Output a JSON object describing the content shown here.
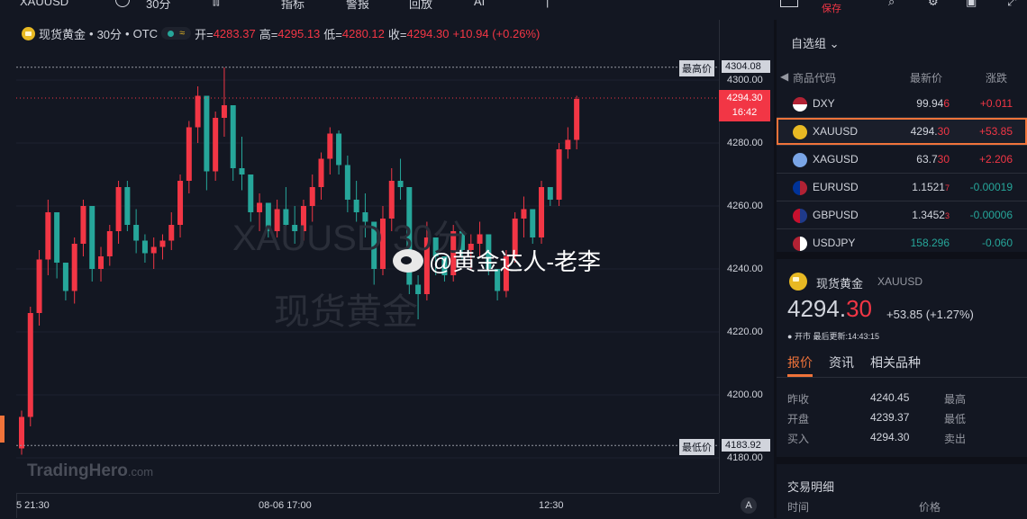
{
  "topbar": {
    "symbol": "XAUUSD",
    "interval": "30分",
    "indicators": "指标",
    "alerts": "警报",
    "replay": "回放",
    "ai": "AI",
    "save": "保存"
  },
  "legend": {
    "name": "现货黄金",
    "interval": "30分",
    "exchange": "OTC",
    "dot_sep": "•",
    "open_label": "开=",
    "open": "4283.37",
    "high_label": "高=",
    "high": "4295.13",
    "low_label": "低=",
    "low": "4280.12",
    "close_label": "收=",
    "close": "4294.30",
    "change": "+10.94 (+0.26%)",
    "pill_icon": "≈"
  },
  "watermark": {
    "line1": "XAUUSD 30分",
    "line2": "现货黄金",
    "brand": "TradingHero",
    "brand_suffix": ".com",
    "social": "@黄金达人-老李"
  },
  "price_axis": {
    "ticks": [
      "4300.00",
      "4280.00",
      "4260.00",
      "4240.00",
      "4220.00",
      "4200.00",
      "4180.00"
    ],
    "high_label": "最高价",
    "high_value": "4304.08",
    "low_label": "最低价",
    "low_value": "4183.92",
    "last_price": "4294.30",
    "countdown": "16:42"
  },
  "time_axis": {
    "ticks": [
      "5 21:30",
      "08-06 17:00",
      "12:30"
    ],
    "auto_button": "A"
  },
  "watchlist": {
    "title": "自选组",
    "headers": {
      "code": "商品代码",
      "last": "最新价",
      "change": "涨跌"
    },
    "rows": [
      {
        "symbol": "DXY",
        "price_main": "99.94",
        "price_tail": "6",
        "change": "+0.011",
        "dir": "up",
        "icon": "us-flag-icon"
      },
      {
        "symbol": "XAUUSD",
        "price_main": "4294.",
        "price_tail": "30",
        "change": "+53.85",
        "dir": "up",
        "icon": "gold-coin-icon"
      },
      {
        "symbol": "XAGUSD",
        "price_main": "63.7",
        "price_tail": "30",
        "change": "+2.206",
        "dir": "up",
        "icon": "silver-coin-icon"
      },
      {
        "symbol": "EURUSD",
        "price_main": "1.1521",
        "price_tail": "7",
        "change": "-0.00019",
        "dir": "down",
        "icon": "eu-us-flag-icon"
      },
      {
        "symbol": "GBPUSD",
        "price_main": "1.3452",
        "price_tail": "3",
        "change": "-0.00006",
        "dir": "down",
        "icon": "gb-us-flag-icon"
      },
      {
        "symbol": "USDJPY",
        "price_main": "158.296",
        "price_tail": "",
        "change": "-0.060",
        "dir": "down",
        "icon": "us-jp-flag-icon"
      }
    ]
  },
  "detail": {
    "name": "现货黄金",
    "symbol": "XAUUSD",
    "price_main": "4294.",
    "price_tail": "30",
    "change": "+53.85 (+1.27%)",
    "status": "开市",
    "updated": "最后更新:14:43:15",
    "tabs": [
      "报价",
      "资讯",
      "相关品种"
    ],
    "quote": [
      {
        "label": "昨收",
        "value": "4240.45",
        "label2": "最高"
      },
      {
        "label": "开盘",
        "value": "4239.37",
        "label2": "最低"
      },
      {
        "label": "买入",
        "value": "4294.30",
        "label2": "卖出"
      }
    ],
    "trades_title": "交易明细",
    "trades_headers": {
      "time": "时间",
      "price": "价格"
    }
  },
  "colors": {
    "up": "#f23645",
    "down": "#26a69a",
    "bg": "#131722",
    "accent": "#e8b923"
  },
  "chart_data": {
    "type": "candlestick",
    "symbol": "XAUUSD",
    "interval": "30分",
    "ylim": [
      4175,
      4310
    ],
    "candles": [
      [
        4183,
        4195,
        4181,
        4193
      ],
      [
        4193,
        4228,
        4190,
        4226
      ],
      [
        4226,
        4246,
        4222,
        4243
      ],
      [
        4243,
        4262,
        4238,
        4258
      ],
      [
        4258,
        4250,
        4237,
        4242
      ],
      [
        4242,
        4236,
        4230,
        4233
      ],
      [
        4233,
        4250,
        4229,
        4248
      ],
      [
        4248,
        4262,
        4244,
        4260
      ],
      [
        4260,
        4255,
        4236,
        4240
      ],
      [
        4240,
        4247,
        4236,
        4244
      ],
      [
        4244,
        4254,
        4241,
        4252
      ],
      [
        4252,
        4268,
        4248,
        4266
      ],
      [
        4266,
        4268,
        4252,
        4254
      ],
      [
        4254,
        4259,
        4245,
        4249
      ],
      [
        4249,
        4251,
        4242,
        4245
      ],
      [
        4245,
        4250,
        4240,
        4247
      ],
      [
        4247,
        4251,
        4243,
        4249
      ],
      [
        4249,
        4258,
        4246,
        4254
      ],
      [
        4254,
        4270,
        4250,
        4268
      ],
      [
        4268,
        4287,
        4264,
        4285
      ],
      [
        4285,
        4298,
        4280,
        4295
      ],
      [
        4295,
        4290,
        4265,
        4271
      ],
      [
        4271,
        4290,
        4268,
        4288
      ],
      [
        4288,
        4304,
        4282,
        4292
      ],
      [
        4292,
        4276,
        4268,
        4272
      ],
      [
        4272,
        4282,
        4265,
        4270
      ],
      [
        4270,
        4262,
        4255,
        4258
      ],
      [
        4258,
        4264,
        4252,
        4261
      ],
      [
        4261,
        4255,
        4250,
        4252
      ],
      [
        4252,
        4262,
        4250,
        4259
      ],
      [
        4259,
        4266,
        4250,
        4254
      ],
      [
        4254,
        4260,
        4248,
        4252
      ],
      [
        4252,
        4262,
        4249,
        4260
      ],
      [
        4260,
        4270,
        4255,
        4266
      ],
      [
        4266,
        4277,
        4262,
        4275
      ],
      [
        4275,
        4285,
        4270,
        4283
      ],
      [
        4283,
        4284,
        4270,
        4273
      ],
      [
        4273,
        4276,
        4258,
        4262
      ],
      [
        4262,
        4268,
        4255,
        4258
      ],
      [
        4258,
        4264,
        4250,
        4255
      ],
      [
        4255,
        4254,
        4235,
        4240
      ],
      [
        4240,
        4260,
        4238,
        4256
      ],
      [
        4256,
        4272,
        4252,
        4268
      ],
      [
        4268,
        4275,
        4262,
        4266
      ],
      [
        4266,
        4262,
        4232,
        4235
      ],
      [
        4235,
        4238,
        4224,
        4232
      ],
      [
        4232,
        4255,
        4230,
        4250
      ],
      [
        4250,
        4247,
        4238,
        4244
      ],
      [
        4244,
        4240,
        4236,
        4238
      ],
      [
        4238,
        4254,
        4236,
        4252
      ],
      [
        4252,
        4249,
        4243,
        4246
      ],
      [
        4246,
        4251,
        4240,
        4248
      ],
      [
        4248,
        4255,
        4244,
        4251
      ],
      [
        4251,
        4248,
        4238,
        4240
      ],
      [
        4240,
        4238,
        4230,
        4233
      ],
      [
        4233,
        4246,
        4231,
        4244
      ],
      [
        4244,
        4258,
        4242,
        4256
      ],
      [
        4256,
        4263,
        4250,
        4259
      ],
      [
        4259,
        4256,
        4248,
        4250
      ],
      [
        4250,
        4268,
        4248,
        4266
      ],
      [
        4266,
        4264,
        4260,
        4262
      ],
      [
        4262,
        4280,
        4260,
        4278
      ],
      [
        4278,
        4285,
        4275,
        4281
      ],
      [
        4281,
        4295,
        4278,
        4294
      ]
    ],
    "high_marker": 4304.08,
    "low_marker": 4183.92,
    "last_price": 4294.3
  }
}
